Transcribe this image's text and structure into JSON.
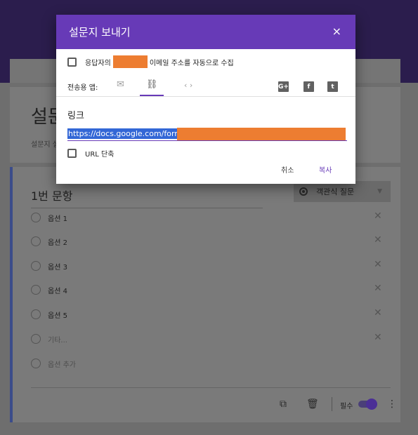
{
  "dialog": {
    "title": "설문지 보내기",
    "close_icon": "×",
    "collect_prefix": "응답자의",
    "collect_suffix": "이메일 주소를 자동으로 수집",
    "send_via_label": "전송용 앱:",
    "send_icons": {
      "email": "✉",
      "link": "⛓",
      "embed": "‹ ›"
    },
    "social": {
      "gplus": "G+",
      "facebook": "f",
      "twitter": "t"
    },
    "link_label": "링크",
    "link_value_visible": "https://docs.google.com/form",
    "shorten_label": "URL 단축",
    "cancel_label": "취소",
    "copy_label": "복사",
    "accent_color": "#673ab7",
    "redaction_color": "#ed7d31"
  },
  "form": {
    "title_visible": "설문",
    "description_visible": "설문지 설"
  },
  "question": {
    "title": "1번 문항",
    "type_label": "객관식 질문",
    "options": [
      "옵션 1",
      "옵션 2",
      "옵션 3",
      "옵션 4",
      "옵션 5"
    ],
    "other_label": "기타...",
    "add_option_label": "옵션 추가",
    "required_label": "필수",
    "required": true
  }
}
